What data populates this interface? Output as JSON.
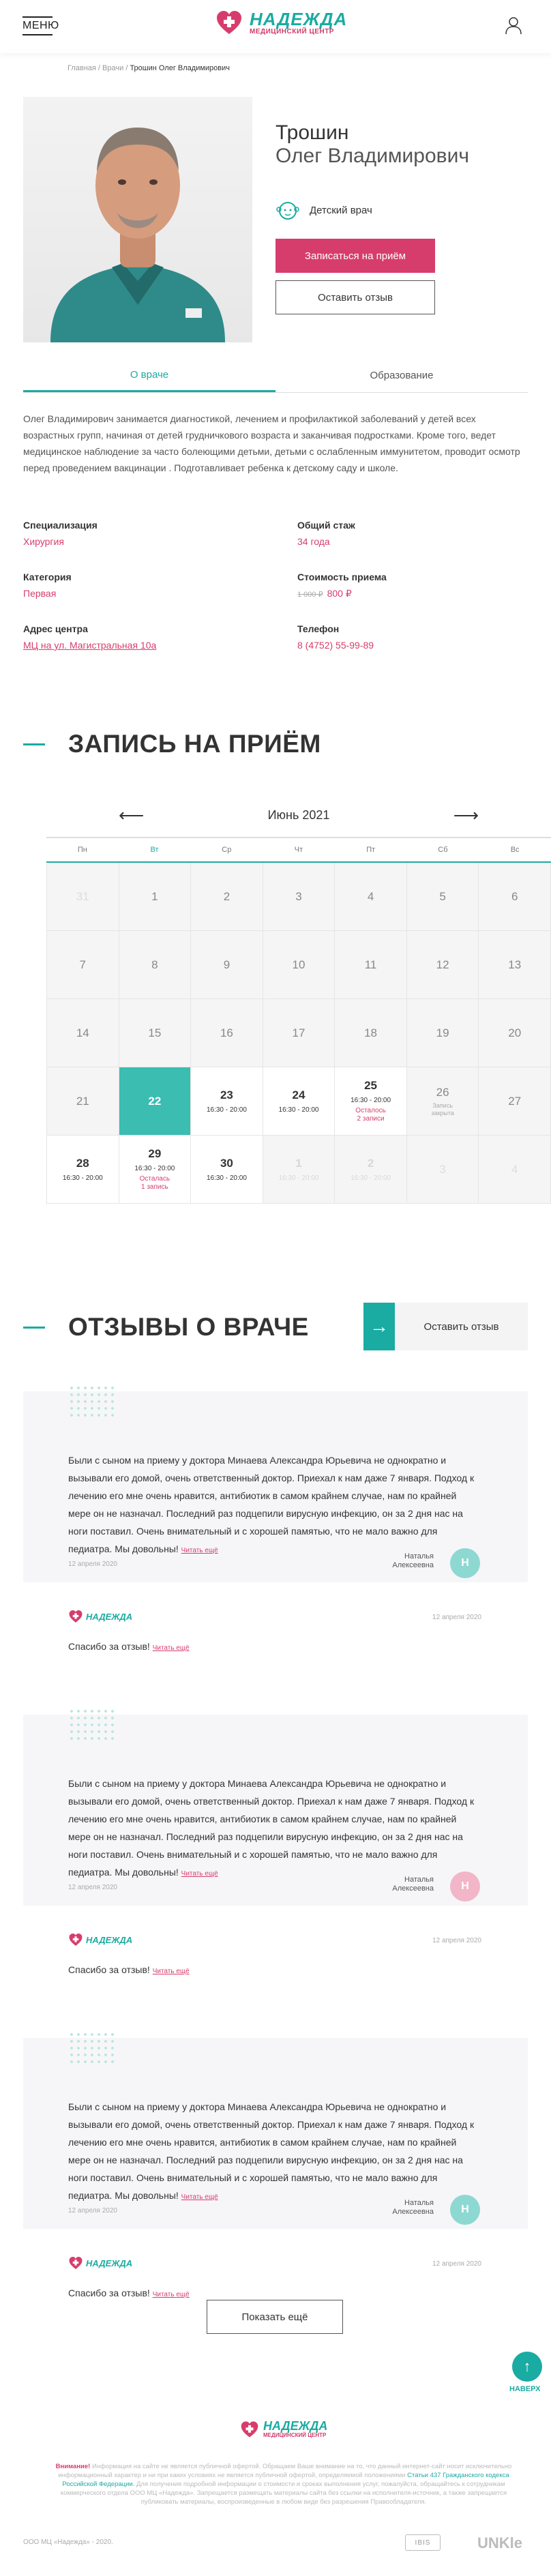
{
  "header": {
    "menu_label": "МЕНЮ",
    "logo_title": "НАДЕЖДА",
    "logo_subtitle": "МЕДИЦИНСКИЙ ЦЕНТР"
  },
  "breadcrumb": {
    "home": "Главная",
    "sep1": " / ",
    "doctors": "Врачи",
    "sep2": " / ",
    "current": "Трошин Олег Владимирович"
  },
  "doctor": {
    "last_name": "Трошин",
    "first_names": "Олег Владимирович",
    "specialty_badge": "Детский врач",
    "book_button": "Записаться на приём",
    "review_button": "Оставить отзыв"
  },
  "tabs": [
    {
      "label": "О враче"
    },
    {
      "label": "Образование"
    }
  ],
  "about": "Олег Владимирович занимается диагностикой, лечением и профилактикой заболеваний у детей всех возрастных групп, начиная от детей грудничкового возраста и заканчивая подростками. Кроме того, ведет медицинское наблюдение за часто болеющими детьми, детьми с ослабленным иммунитетом, проводит осмотр перед проведением вакцинации . Подготавливает ребенка к детскому саду и школе.",
  "info": {
    "specialization_label": "Специализация",
    "specialization": "Хирургия",
    "experience_label": "Общий стаж",
    "experience": "34 года",
    "category_label": "Категория",
    "category": "Первая",
    "price_label": "Стоимость приема",
    "price_old": "1 000 ₽",
    "price": "800 ₽",
    "address_label": "Адрес центра",
    "address": "МЦ на ул. Магистральная 10а",
    "phone_label": "Телефон",
    "phone": "8 (4752) 55-99-89"
  },
  "booking": {
    "title": "ЗАПИСЬ НА ПРИЁМ",
    "month": "Июнь 2021",
    "weekdays": [
      "Пн",
      "Вт",
      "Ср",
      "Чт",
      "Пт",
      "Сб",
      "Вс"
    ],
    "cells": [
      {
        "day": "31",
        "state": "muted"
      },
      {
        "day": "1"
      },
      {
        "day": "2"
      },
      {
        "day": "3"
      },
      {
        "day": "4"
      },
      {
        "day": "5"
      },
      {
        "day": "6"
      },
      {
        "day": "7"
      },
      {
        "day": "8"
      },
      {
        "day": "9"
      },
      {
        "day": "10"
      },
      {
        "day": "11"
      },
      {
        "day": "12"
      },
      {
        "day": "13"
      },
      {
        "day": "14"
      },
      {
        "day": "15"
      },
      {
        "day": "16"
      },
      {
        "day": "17"
      },
      {
        "day": "18"
      },
      {
        "day": "19"
      },
      {
        "day": "20"
      },
      {
        "day": "21"
      },
      {
        "day": "22",
        "state": "sel"
      },
      {
        "day": "23",
        "state": "avail",
        "time": "16:30 - 20:00"
      },
      {
        "day": "24",
        "state": "avail",
        "time": "16:30 - 20:00"
      },
      {
        "day": "25",
        "state": "avail",
        "time": "16:30 - 20:00",
        "left": "Осталось\n2 записи"
      },
      {
        "day": "26",
        "state": "note",
        "note": "Запись\nзакрыта"
      },
      {
        "day": "27"
      },
      {
        "day": "28",
        "state": "avail",
        "time": "16:30 - 20:00"
      },
      {
        "day": "29",
        "state": "avail",
        "time": "16:30 - 20:00",
        "left": "Осталась\n1 запись"
      },
      {
        "day": "30",
        "state": "avail",
        "time": "16:30 - 20:00"
      },
      {
        "day": "1",
        "state": "past-avail",
        "time": "16:30 - 20:00"
      },
      {
        "day": "2",
        "state": "past-avail",
        "time": "16:30 - 20:00"
      },
      {
        "day": "3",
        "state": "muted"
      },
      {
        "day": "4",
        "state": "muted"
      }
    ]
  },
  "reviews": {
    "title": "ОТЗЫВЫ О ВРАЧЕ",
    "leave_button": "Оставить отзыв",
    "items": [
      {
        "text": "Были с сыном на приему у доктора Минаева Александра Юрьевича не однократно и вызывали его домой, очень ответственный доктор. Приехал к нам даже 7 января. Подход к лечению его мне очень нравится, антибиотик в самом крайнем случае, нам по крайней мере он не назначал. Последний раз подцепили вирусную инфекцию, он за 2 дня нас на ноги поставил. Очень внимательный и с хорошей памятью, что не мало важно для педиатра. Мы довольны!",
        "more": "Читать ещё",
        "date": "12 апреля 2020",
        "author": "Наталья\nАлексеевна",
        "initial": "Н",
        "avatar_color": "#8ed8d2",
        "reply_logo": "НАДЕЖДА",
        "reply_date": "12 апреля 2020",
        "reply_text": "Спасибо за отзыв!",
        "reply_more": "Читать ещё"
      },
      {
        "text": "Были с сыном на приему у доктора Минаева Александра Юрьевича не однократно и вызывали его домой, очень ответственный доктор. Приехал к нам даже 7 января. Подход к лечению его мне очень нравится, антибиотик в самом крайнем случае, нам по крайней мере он не назначал. Последний раз подцепили вирусную инфекцию, он за 2 дня нас на ноги поставил. Очень внимательный и с хорошей памятью, что не мало важно для педиатра. Мы довольны!",
        "more": "Читать ещё",
        "date": "12 апреля 2020",
        "author": "Наталья\nАлексеевна",
        "initial": "Н",
        "avatar_color": "#f2b6c8",
        "reply_logo": "НАДЕЖДА",
        "reply_date": "12 апреля 2020",
        "reply_text": "Спасибо за отзыв!",
        "reply_more": "Читать ещё"
      },
      {
        "text": "Были с сыном на приему у доктора Минаева Александра Юрьевича не однократно и вызывали его домой, очень ответственный доктор. Приехал к нам даже 7 января. Подход к лечению его мне очень нравится, антибиотик в самом крайнем случае, нам по крайней мере он не назначал. Последний раз подцепили вирусную инфекцию, он за 2 дня нас на ноги поставил. Очень внимательный и с хорошей памятью, что не мало важно для педиатра. Мы довольны!",
        "more": "Читать ещё",
        "date": "12 апреля 2020",
        "author": "Наталья\nАлексеевна",
        "initial": "Н",
        "avatar_color": "#8ed8d2",
        "reply_logo": "НАДЕЖДА",
        "reply_date": "12 апреля 2020",
        "reply_text": "Спасибо за отзыв!",
        "reply_more": "Читать ещё"
      }
    ],
    "show_more": "Показать ещё"
  },
  "scroll_top_label": "НАВЕРХ",
  "footer": {
    "logo_title": "НАДЕЖДА",
    "logo_subtitle": "МЕДИЦИНСКИЙ ЦЕНТР",
    "note_bold": "Внимание!",
    "note_part1": " Информация на сайте не является публичной офертой. Обращаем Ваше внимание на то, что данный интернет-сайт носит исключительно информационный характер и ни при каких условиях не является публичной офертой, определяемой положениями ",
    "note_link": "Статьи 437 Гражданского кодекса Российской Федерации.",
    "note_part2": " Для получения подробной информации о стоимости и сроках выполнения услуг, пожалуйста, обращайтесь к сотрудникам коммерческого отдела ООО МЦ «Надежда». Запрещается размещать материалы сайта без ссылки на исполнителя-источник, а также запрещается публиковать материалы, воспроизведенные в любом виде без разрешения Правообладателя.",
    "copyright": "ООО МЦ «Надежда» - 2020.",
    "dev_badge": "IBIS",
    "dev_name": "UNKle"
  },
  "colors": {
    "accent": "#1aaba2",
    "brand_pink": "#d73d6c"
  }
}
